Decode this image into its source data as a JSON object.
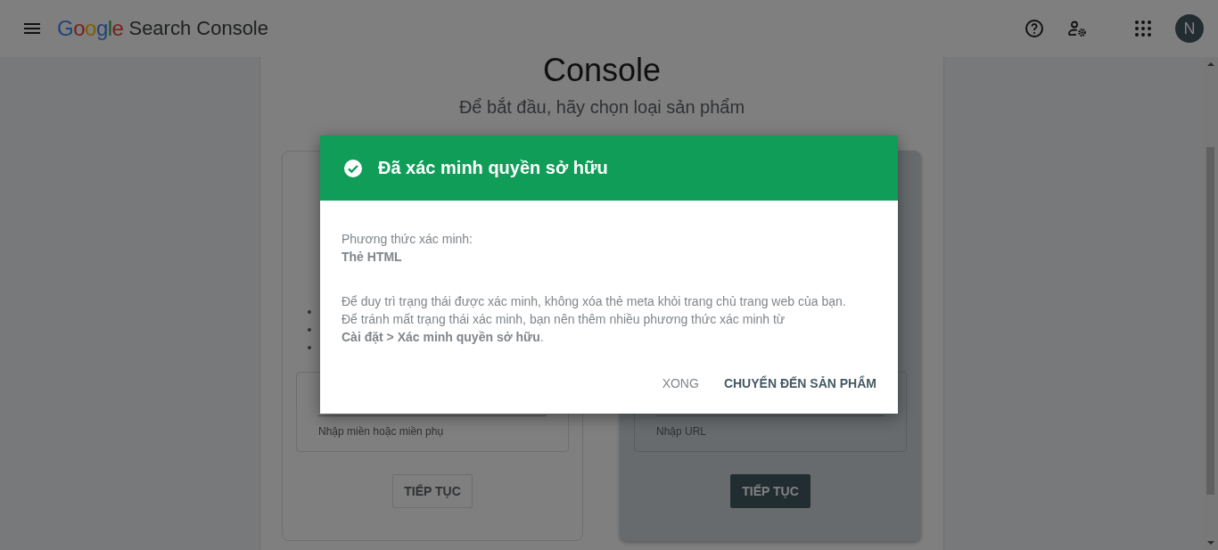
{
  "header": {
    "logo": "Google",
    "product": "Search Console",
    "avatar": "N"
  },
  "page": {
    "title": "Console",
    "subtitle": "Để bắt đầu, hãy chọn loại sản phẩm",
    "cards": [
      {
        "selected": false,
        "field_hint": "Nhập miền hoặc miền phụ",
        "button": "TIẾP TỤC"
      },
      {
        "selected": true,
        "field_hint": "Nhập URL",
        "button": "TIẾP TỤC"
      }
    ]
  },
  "dialog": {
    "title": "Đã xác minh quyền sở hữu",
    "method_label": "Phương thức xác minh:",
    "method": "Thẻ HTML",
    "note": "Để duy trì trạng thái được xác minh, không xóa thẻ meta khỏi trang chủ trang web của bạn.\nĐể tránh mất trạng thái xác minh, bạn nên thêm nhiều phương thức xác minh từ\n**Cài đặt > Xác minh quyền sở hữu**.",
    "buttons": [
      {
        "label": "XONG",
        "primary": false
      },
      {
        "label": "CHUYỂN ĐẾN SẢN PHẨM",
        "primary": true
      }
    ]
  }
}
